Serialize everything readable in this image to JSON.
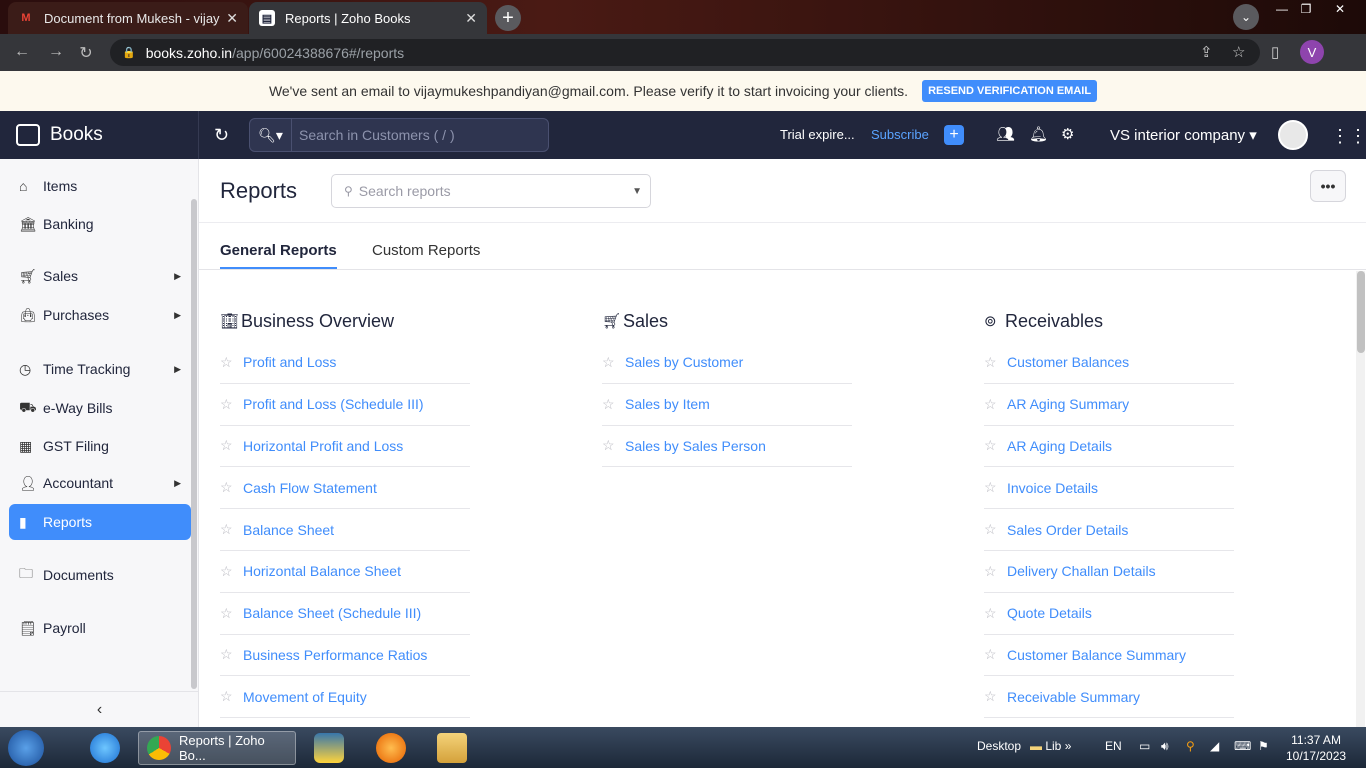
{
  "browser": {
    "tabs": [
      {
        "title": "Document from Mukesh - vijaym",
        "favicon": "gmail-icon",
        "active": false
      },
      {
        "title": "Reports | Zoho Books",
        "favicon": "zoho-books-icon",
        "active": true
      }
    ],
    "url_host": "books.zoho.in",
    "url_path": "/app/60024388676#/reports",
    "profile_initial": "V"
  },
  "banner": {
    "message": "We've sent an email to vijaymukeshpandiyan@gmail.com. Please verify it to start invoicing your clients.",
    "button_label": "RESEND VERIFICATION EMAIL"
  },
  "topbar": {
    "brand": "Books",
    "search_placeholder": "Search in Customers ( / )",
    "trial_text": "Trial expire...",
    "subscribe_label": "Subscribe",
    "company_name": "VS interior company"
  },
  "sidebar": {
    "items": [
      {
        "label": "Items",
        "icon": "items-icon",
        "has_arrow": false
      },
      {
        "label": "Banking",
        "icon": "bank-icon",
        "has_arrow": false
      },
      {
        "label": "Sales",
        "icon": "cart-icon",
        "has_arrow": true
      },
      {
        "label": "Purchases",
        "icon": "bag-icon",
        "has_arrow": true
      },
      {
        "label": "Time Tracking",
        "icon": "clock-icon",
        "has_arrow": true
      },
      {
        "label": "e-Way Bills",
        "icon": "truck-icon",
        "has_arrow": false
      },
      {
        "label": "GST Filing",
        "icon": "gst-icon",
        "has_arrow": false
      },
      {
        "label": "Accountant",
        "icon": "person-icon",
        "has_arrow": true
      },
      {
        "label": "Reports",
        "icon": "chart-icon",
        "has_arrow": false,
        "active": true
      },
      {
        "label": "Documents",
        "icon": "folder-icon",
        "has_arrow": false
      },
      {
        "label": "Payroll",
        "icon": "payroll-icon",
        "has_arrow": false
      }
    ]
  },
  "main": {
    "title": "Reports",
    "search_placeholder": "Search reports",
    "tabs": [
      {
        "label": "General Reports",
        "active": true
      },
      {
        "label": "Custom Reports",
        "active": false
      }
    ],
    "columns": [
      {
        "heading": "Business Overview",
        "icon": "building-icon",
        "items": [
          "Profit and Loss",
          "Profit and Loss (Schedule III)",
          "Horizontal Profit and Loss",
          "Cash Flow Statement",
          "Balance Sheet",
          "Horizontal Balance Sheet",
          "Balance Sheet (Schedule III)",
          "Business Performance Ratios",
          "Movement of Equity"
        ]
      },
      {
        "heading": "Sales",
        "icon": "cart-icon",
        "items": [
          "Sales by Customer",
          "Sales by Item",
          "Sales by Sales Person"
        ]
      },
      {
        "heading": "Receivables",
        "icon": "receivables-icon",
        "items": [
          "Customer Balances",
          "AR Aging Summary",
          "AR Aging Details",
          "Invoice Details",
          "Sales Order Details",
          "Delivery Challan Details",
          "Quote Details",
          "Customer Balance Summary",
          "Receivable Summary"
        ]
      }
    ]
  },
  "taskbar": {
    "active_app": "Reports | Zoho Bo...",
    "desktop_label": "Desktop",
    "lib_label": "Lib",
    "lang": "EN",
    "time": "11:37 AM",
    "date": "10/17/2023"
  },
  "colors": {
    "accent": "#408dfb",
    "topbar": "#21263c",
    "banner": "#fdf9ee"
  }
}
